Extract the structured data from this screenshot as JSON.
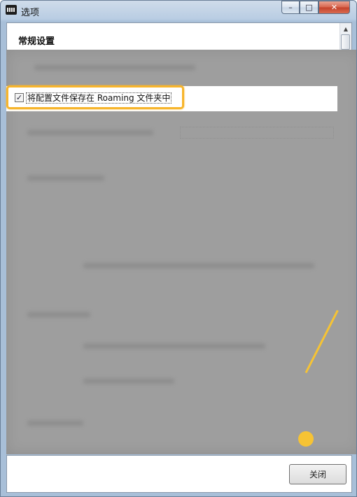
{
  "window": {
    "title": "选项",
    "controls": {
      "minimize": "–",
      "maximize": "□",
      "close": "✕"
    }
  },
  "section": {
    "title": "常规设置"
  },
  "option": {
    "label": "将配置文件保存在 Roaming 文件夹中",
    "checked": true,
    "check_glyph": "✓"
  },
  "footer": {
    "close_label": "关闭"
  },
  "scrollbar": {
    "up_glyph": "▲"
  },
  "colors": {
    "highlight": "#f7b52c",
    "pointer": "#f6c334",
    "overlay": "#9e9e9e"
  }
}
